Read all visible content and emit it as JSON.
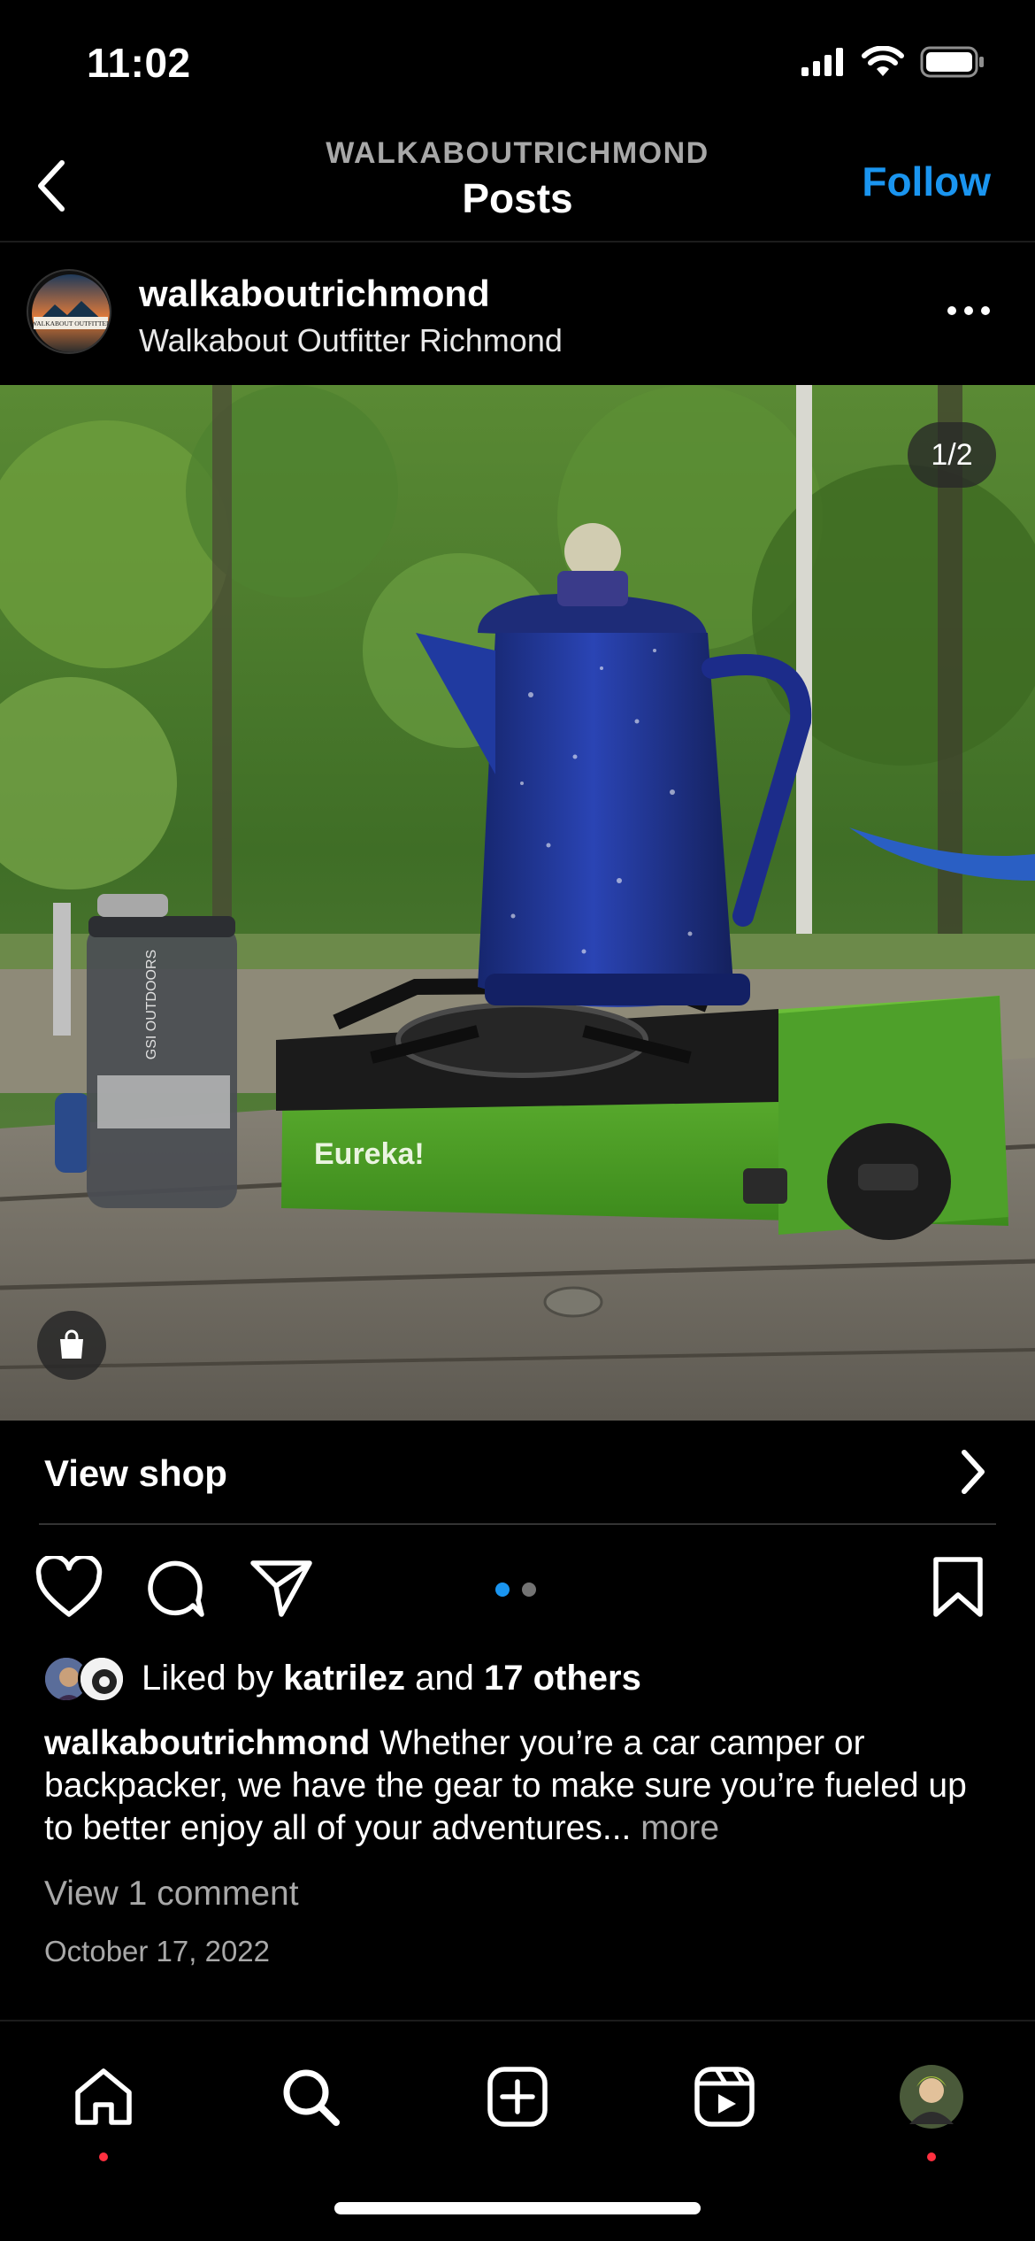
{
  "status_bar": {
    "time": "11:02"
  },
  "header": {
    "account": "WALKABOUTRICHMOND",
    "title": "Posts",
    "follow_label": "Follow",
    "accent_color": "#1a95f0"
  },
  "post": {
    "username": "walkaboutrichmond",
    "location": "Walkabout Outfitter Richmond",
    "avatar_text": "WALKABOUT OUTFITTER",
    "image_counter": "1/2",
    "image_brand_text": "Eureka!",
    "grinder_text": "GSI OUTDOORS",
    "view_shop_label": "View shop",
    "likes": {
      "prefix": "Liked by",
      "first_user": "katrilez",
      "conjunction": "and",
      "others": "17 others"
    },
    "caption": {
      "username": "walkaboutrichmond",
      "text": "Whether you’re a car camper or backpacker, we have the gear to make sure you’re fueled up to better enjoy all of your adventures...",
      "more_label": "more"
    },
    "comments_label": "View 1 comment",
    "date": "October 17, 2022"
  },
  "icons": {
    "back": "chevron-left-icon",
    "more": "ellipsis-icon",
    "like": "heart-icon",
    "comment": "comment-icon",
    "share": "paper-plane-icon",
    "save": "bookmark-icon",
    "shop": "shopping-bag-icon"
  },
  "tabs": [
    "home",
    "search",
    "create",
    "reels",
    "profile"
  ],
  "colors": {
    "notification_dot": "#ff3040",
    "pager_active": "#1a95f0",
    "pager_inactive": "#737373"
  }
}
